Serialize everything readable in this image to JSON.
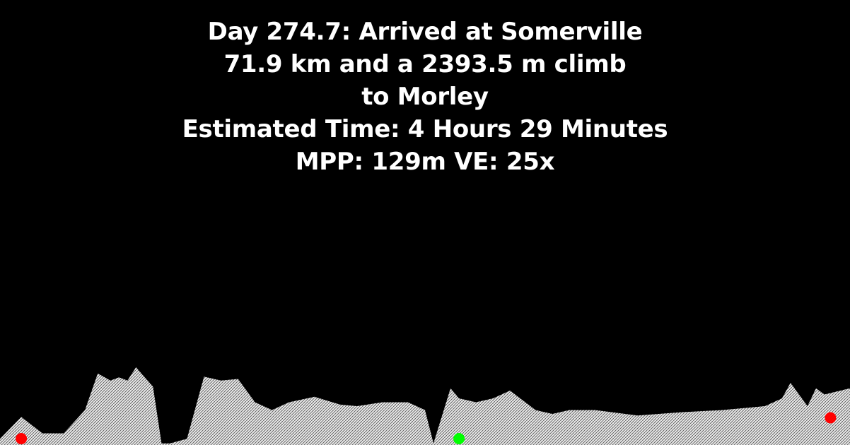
{
  "caption": {
    "line1": "Day 274.7: Arrived at Somerville",
    "line2": "71.9 km and a 2393.5 m climb",
    "line3": "to Morley",
    "line4": "Estimated Time: 4 Hours 29 Minutes",
    "line5": "MPP: 129m VE: 25x"
  },
  "colors": {
    "background": "#000000",
    "text": "#ffffff",
    "terrain_fill": "#e8e8e8",
    "terrain_hatch": "#555555",
    "marker_endpoint": "#ff0000",
    "marker_current": "#00ff00"
  },
  "elevation_profile": {
    "x": [
      0,
      2.5,
      5,
      7.5,
      10,
      11.5,
      13,
      14,
      15,
      16,
      18,
      19,
      20,
      22,
      24,
      26,
      28,
      30,
      32,
      34,
      37,
      40,
      42,
      45,
      48,
      50,
      51,
      53,
      54,
      56,
      58,
      60,
      63,
      65,
      67,
      70,
      75,
      80,
      85,
      90,
      92,
      93,
      95,
      96,
      97,
      100
    ],
    "y": [
      0.08,
      0.36,
      0.15,
      0.15,
      0.45,
      0.92,
      0.83,
      0.87,
      0.83,
      1.0,
      0.75,
      0.02,
      0.02,
      0.08,
      0.88,
      0.83,
      0.85,
      0.55,
      0.45,
      0.55,
      0.62,
      0.52,
      0.5,
      0.55,
      0.55,
      0.45,
      0.02,
      0.73,
      0.6,
      0.55,
      0.6,
      0.7,
      0.45,
      0.4,
      0.45,
      0.45,
      0.38,
      0.42,
      0.45,
      0.5,
      0.6,
      0.8,
      0.5,
      0.73,
      0.65,
      0.73
    ]
  },
  "markers": [
    {
      "name": "start",
      "x": 2.5,
      "y": 0.08,
      "color": "#ff0000"
    },
    {
      "name": "current",
      "x": 54,
      "y": 0.02,
      "color": "#00ff00"
    },
    {
      "name": "end",
      "x": 97.7,
      "y": 0.35,
      "color": "#ff0000"
    }
  ]
}
